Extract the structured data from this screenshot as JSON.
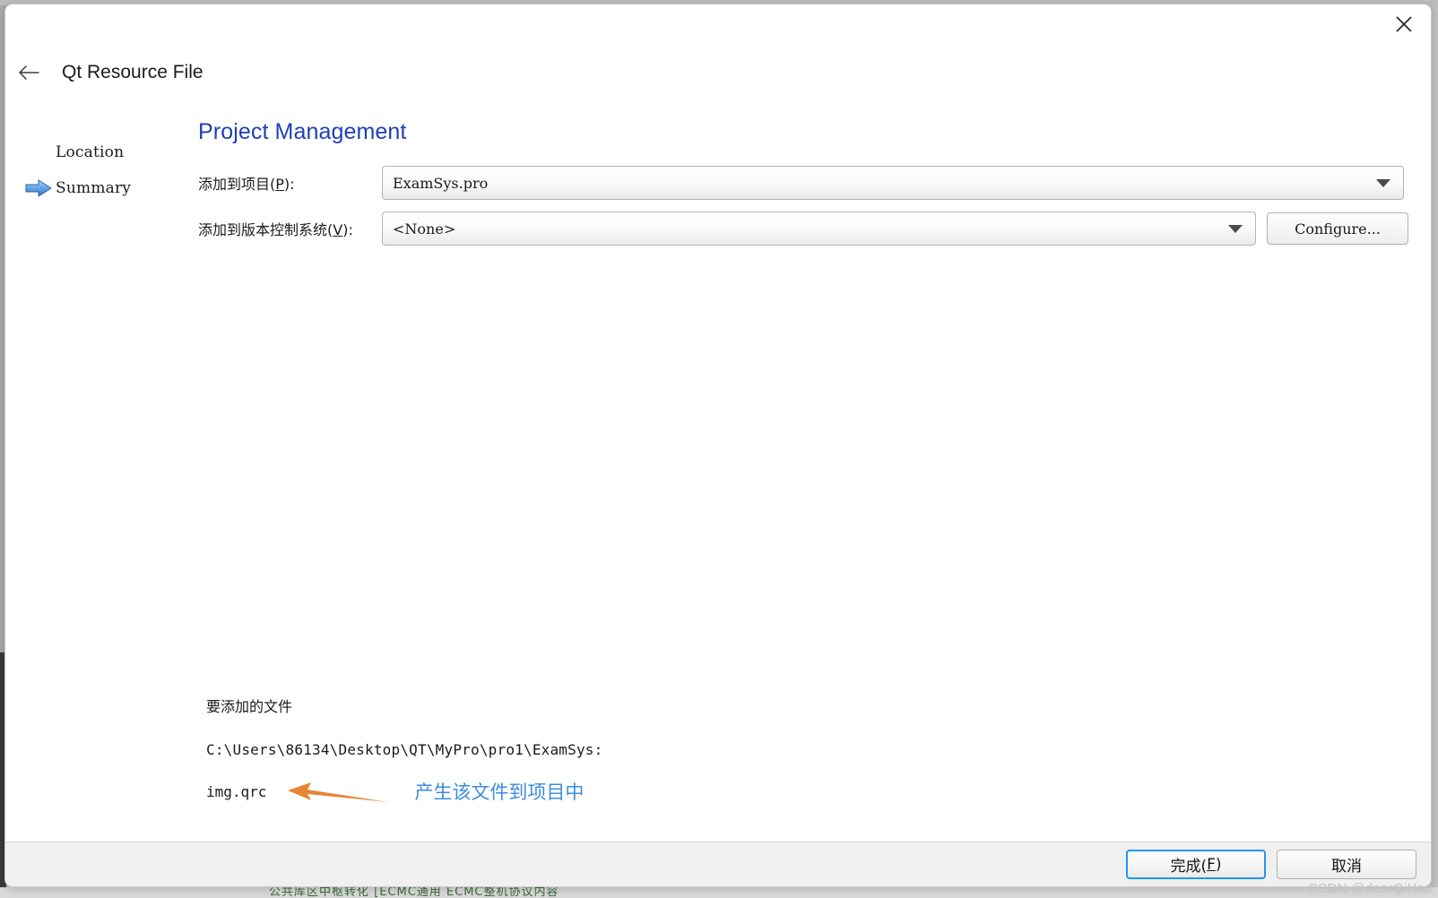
{
  "window": {
    "title": "Qt Resource File",
    "close_icon": "close-icon",
    "back_icon": "back-arrow-icon"
  },
  "steps": [
    {
      "label": "Location",
      "active": false,
      "marker": "none"
    },
    {
      "label": "Summary",
      "active": true,
      "marker": "blue-arrow-icon"
    }
  ],
  "main": {
    "section_title": "Project Management",
    "title_color": "#1e3fb8",
    "fields": [
      {
        "label_prefix": "添加到项目(",
        "label_mnemonic": "P",
        "label_suffix": "):",
        "value": "ExamSys.pro"
      },
      {
        "label_prefix": "添加到版本控制系统(",
        "label_mnemonic": "V",
        "label_suffix": "):",
        "value": "<None>"
      }
    ],
    "configure_label": "Configure..."
  },
  "summary": {
    "files_heading": "要添加的文件",
    "path": "C:\\Users\\86134\\Desktop\\QT\\MyPro\\pro1\\ExamSys:",
    "file_name": "img.qrc"
  },
  "annotation": {
    "text": "产生该文件到项目中",
    "text_color": "#3d8ce0",
    "arrow_color": "#e8833a",
    "arrow_icon": "left-arrow-annotation-icon"
  },
  "footer": {
    "finish_prefix": "完成(",
    "finish_mnemonic": "F",
    "finish_suffix": ")",
    "cancel_label": "取消",
    "accent_color": "#2196f3"
  },
  "watermark": {
    "text": "CSDN @dearQiHao"
  },
  "background": {
    "bottom_strip_text": "公共库区中枢转化 [ECMC通用 ECMC整机协议内容"
  }
}
